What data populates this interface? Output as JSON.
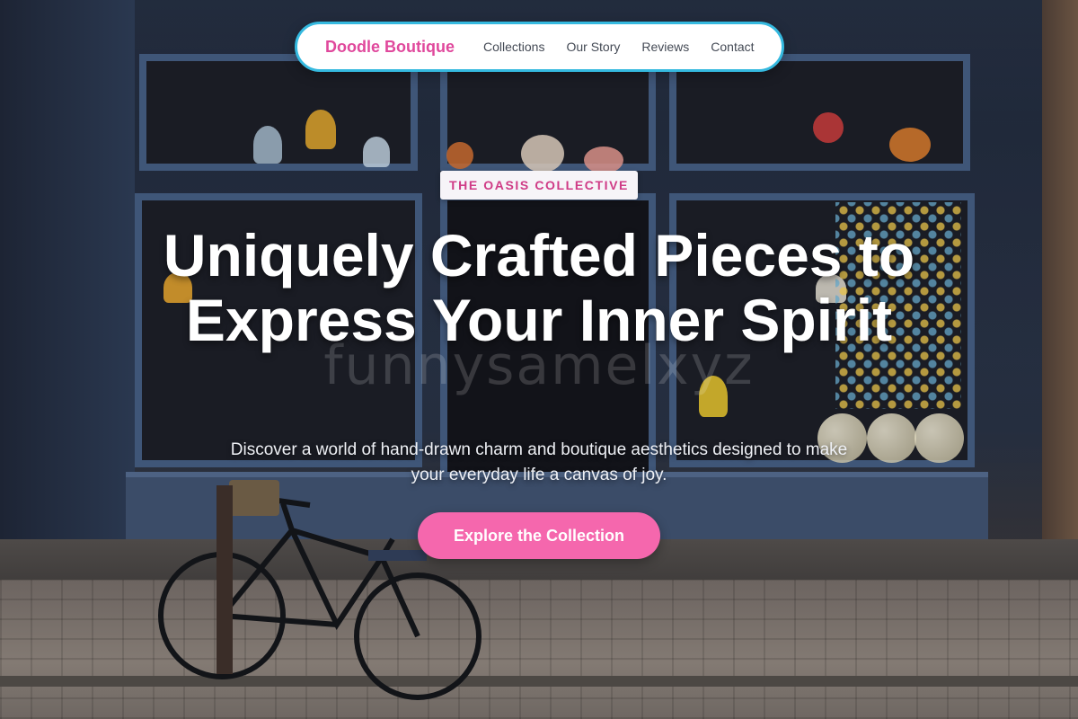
{
  "nav": {
    "brand": "Doodle Boutique",
    "links": [
      {
        "label": "Collections"
      },
      {
        "label": "Our Story"
      },
      {
        "label": "Reviews"
      },
      {
        "label": "Contact"
      }
    ]
  },
  "hero": {
    "badge": "THE OASIS COLLECTIVE",
    "headline": "Uniquely Crafted Pieces to Express Your Inner Spirit",
    "watermark": "funnysamelxyz",
    "subtext": "Discover a world of hand-drawn charm and boutique aesthetics designed to make your everyday life a canvas of joy.",
    "cta_label": "Explore the Collection"
  },
  "colors": {
    "brand_pink": "#e0489c",
    "cta_pink": "#f567ad",
    "nav_border": "#35b9df",
    "badge_text": "#cf3b86"
  }
}
